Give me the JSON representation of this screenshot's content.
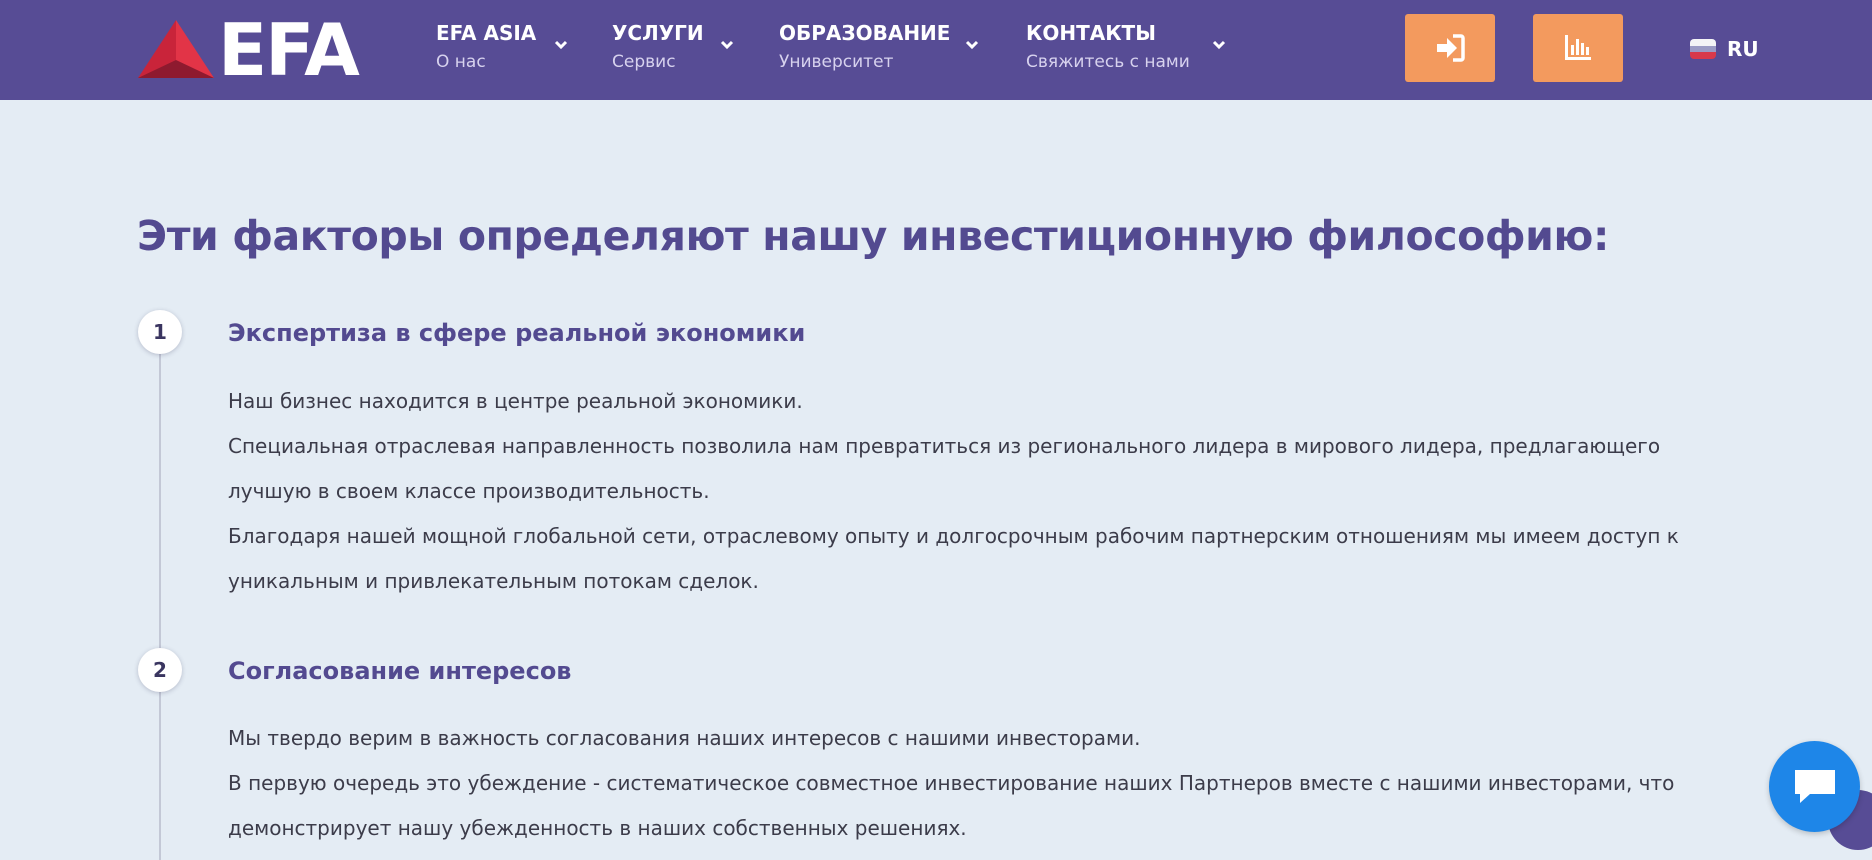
{
  "header": {
    "logo_text": "EFA",
    "nav": [
      {
        "title": "EFA ASIA",
        "subtitle": "О нас"
      },
      {
        "title": "УСЛУГИ",
        "subtitle": "Сервис"
      },
      {
        "title": "ОБРАЗОВАНИЕ",
        "subtitle": "Университет"
      },
      {
        "title": "КОНТАКТЫ",
        "subtitle": "Свяжитесь с нами"
      }
    ],
    "buttons": [
      {
        "icon": "login-icon"
      },
      {
        "icon": "bar-chart-icon"
      }
    ],
    "language": "RU"
  },
  "content": {
    "title": "Эти факторы определяют нашу инвестиционную философию:",
    "steps": [
      {
        "number": "1",
        "heading": "Экспертиза в сфере реальной экономики",
        "lines": [
          "Наш бизнес находится в центре реальной экономики.",
          "Специальная отраслевая направленность позволила нам превратиться из регионального лидера в мирового лидера, предлагающего",
          "лучшую в своем классе производительность.",
          "Благодаря нашей мощной глобальной сети, отраслевому опыту и долгосрочным рабочим партнерским отношениям мы имеем доступ к",
          "уникальным и привлекательным потокам сделок."
        ]
      },
      {
        "number": "2",
        "heading": "Согласование интересов",
        "lines": [
          "Мы твердо верим в важность согласования наших интересов с нашими инвесторами.",
          "В первую очередь это убеждение - систематическое совместное инвестирование наших Партнеров вместе с нашими инвесторами, что",
          "демонстрирует нашу убежденность в наших собственных решениях."
        ]
      }
    ]
  },
  "colors": {
    "header_bg": "#574c95",
    "page_bg": "#e4ecf4",
    "accent_orange": "#f39a5e",
    "heading_purple": "#534a90",
    "chat_blue": "#1e86e8"
  }
}
